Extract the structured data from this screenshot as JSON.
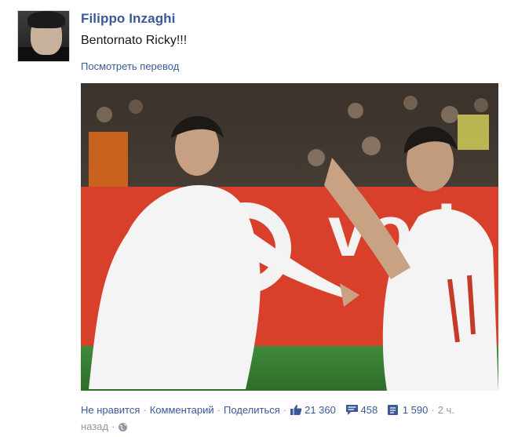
{
  "post": {
    "author": "Filippo Inzaghi",
    "text": "Bentornato Ricky!!!",
    "translate": "Посмотреть перевод"
  },
  "actions": {
    "unlike": "Не нравится",
    "comment": "Комментарий",
    "share": "Поделиться",
    "likes_count": "21 360",
    "comments_count": "458",
    "shares_count": "1 590",
    "time_part1": "2 ч.",
    "time_part2": "назад"
  },
  "icons": {
    "like": "thumbs-up-icon",
    "comments": "comment-bubble-icon",
    "shares": "share-icon",
    "privacy": "globe-icon"
  },
  "colors": {
    "link": "#3b5998",
    "meta": "#9197a3"
  }
}
